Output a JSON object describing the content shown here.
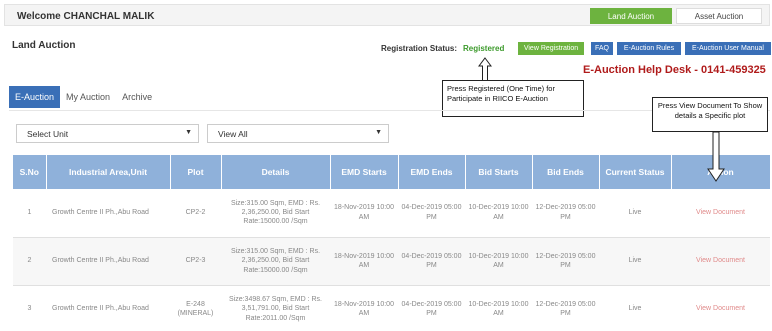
{
  "header": {
    "welcome": "Welcome CHANCHAL MALIK",
    "land_auction": "Land Auction",
    "asset_auction": "Asset Auction"
  },
  "page": {
    "title": "Land Auction",
    "reg_label": "Registration Status:",
    "reg_value": "Registered",
    "view_registration": "View Registration",
    "faq": "FAQ",
    "rules": "E-Auction Rules",
    "manual": "E-Auction User Manual",
    "helpdesk": "E-Auction Help Desk - 0141-459325"
  },
  "callouts": {
    "registration": "Press Registered (One Time) for Participate in RIICO E-Auction",
    "document": "Press View Document To Show details a Specific plot"
  },
  "tabs": [
    "E-Auction",
    "My Auction",
    "Archive"
  ],
  "filters": {
    "unit": "Select Unit",
    "view": "View All"
  },
  "table": {
    "headers": [
      "S.No",
      "Industrial Area,Unit",
      "Plot",
      "Details",
      "EMD Starts",
      "EMD Ends",
      "Bid Starts",
      "Bid Ends",
      "Current Status",
      "Action"
    ],
    "rows": [
      {
        "sno": "1",
        "area": "Growth Centre II Ph.,Abu Road",
        "plot": "CP2-2",
        "details": "Size:315.00 Sqm, EMD : Rs. 2,36,250.00, Bid Start Rate:15000.00 /Sqm",
        "emd_start": "18-Nov-2019 10:00 AM",
        "emd_end": "04-Dec-2019 05:00 PM",
        "bid_start": "10-Dec-2019 10:00 AM",
        "bid_end": "12-Dec-2019 05:00 PM",
        "status": "Live",
        "action": "View Document"
      },
      {
        "sno": "2",
        "area": "Growth Centre II Ph.,Abu Road",
        "plot": "CP2-3",
        "details": "Size:315.00 Sqm, EMD : Rs. 2,36,250.00, Bid Start Rate:15000.00 /Sqm",
        "emd_start": "18-Nov-2019 10:00 AM",
        "emd_end": "04-Dec-2019 05:00 PM",
        "bid_start": "10-Dec-2019 10:00 AM",
        "bid_end": "12-Dec-2019 05:00 PM",
        "status": "Live",
        "action": "View Document"
      },
      {
        "sno": "3",
        "area": "Growth Centre II Ph.,Abu Road",
        "plot": "E-248 (MINERAL)",
        "details": "Size:3498.67 Sqm, EMD : Rs. 3,51,791.00, Bid Start Rate:2011.00 /Sqm",
        "emd_start": "18-Nov-2019 10:00 AM",
        "emd_end": "04-Dec-2019 05:00 PM",
        "bid_start": "10-Dec-2019 10:00 AM",
        "bid_end": "12-Dec-2019 05:00 PM",
        "status": "Live",
        "action": "View Document"
      }
    ]
  }
}
